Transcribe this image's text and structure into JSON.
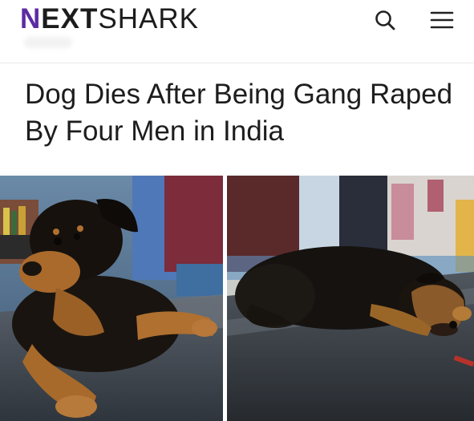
{
  "header": {
    "logo": {
      "first_letter": "N",
      "bold_part": "EXT",
      "regular_part": "SHARK",
      "accent_color": "#5b2ba2"
    },
    "search_icon": "search-icon",
    "menu_icon": "hamburger-menu-icon"
  },
  "article": {
    "headline": "Dog Dies After Being Gang Raped By Four Men in India"
  },
  "photos": [
    {
      "name": "photo-dog-sitting",
      "subject": "dog-sitting-on-table"
    },
    {
      "name": "photo-dog-lying",
      "subject": "dog-lying-on-table"
    }
  ]
}
